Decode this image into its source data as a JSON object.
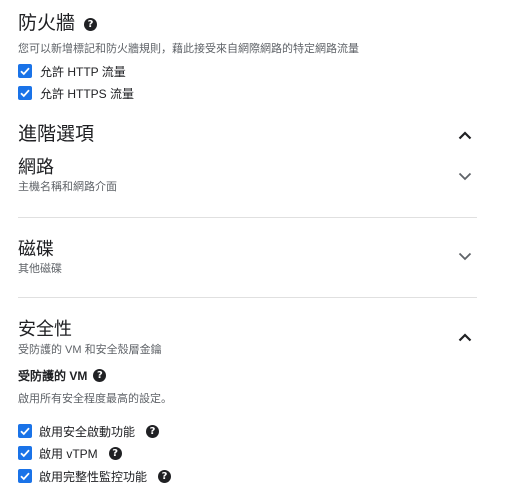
{
  "firewall": {
    "title": "防火牆",
    "help_icon": "help-circle-icon",
    "description": "您可以新增標記和防火牆規則，藉此接受來自網際網路的特定網路流量",
    "options": [
      {
        "label": "允許 HTTP 流量",
        "checked": true
      },
      {
        "label": "允許 HTTPS 流量",
        "checked": true
      }
    ]
  },
  "advanced": {
    "title": "進階選項",
    "expanded": true
  },
  "networking": {
    "title": "網路",
    "subtitle": "主機名稱和網路介面",
    "expanded": false
  },
  "disks": {
    "title": "磁碟",
    "subtitle": "其他磁碟",
    "expanded": false
  },
  "security": {
    "title": "安全性",
    "subtitle": "受防護的 VM 和安全殼層金鑰",
    "expanded": true,
    "shielded_vm": {
      "label": "受防護的 VM",
      "description": "啟用所有安全程度最高的設定。",
      "options": [
        {
          "label": "啟用安全啟動功能",
          "checked": true
        },
        {
          "label": "啟用 vTPM",
          "checked": true
        },
        {
          "label": "啟用完整性監控功能",
          "checked": true
        }
      ]
    }
  },
  "colors": {
    "accent": "#1a73e8",
    "divider": "#e0e0e0",
    "text": "#202124",
    "secondary_text": "#5f6368"
  }
}
